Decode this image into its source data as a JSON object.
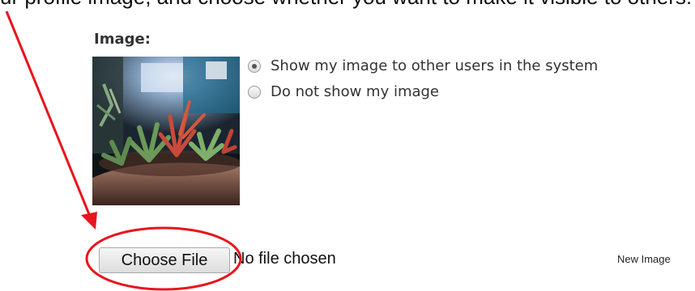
{
  "top_text": "ur profile image, and choose whether you want to make it visible to others:",
  "image_section": {
    "label": "Image:",
    "image_description_icon": "succulent-plants-photo"
  },
  "visibility": {
    "options": [
      {
        "label": "Show my image to other users in the system",
        "checked": true
      },
      {
        "label": "Do not show my image",
        "checked": false
      }
    ]
  },
  "file_input": {
    "button_label": "Choose File",
    "status": "No file chosen",
    "side_label": "New Image"
  },
  "annotation": {
    "color": "#e8141c"
  }
}
